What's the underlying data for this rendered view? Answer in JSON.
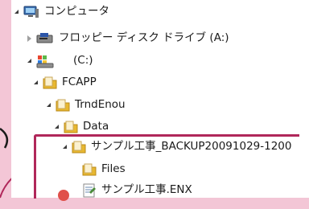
{
  "tree": {
    "computer": "コンピュータ",
    "floppy": "フロッピー ディスク ドライブ (A:)",
    "cdrive": "(C:)",
    "fcapp": "FCAPP",
    "trndenou": "TrndEnou",
    "data": "Data",
    "backup": "サンプル工事_BACKUP20091029-1200",
    "files": "Files",
    "enx": "サンプル工事.ENX"
  },
  "colors": {
    "background": "#f3c6d6",
    "highlight_border": "#b0275a",
    "folder": "#e8b830"
  }
}
